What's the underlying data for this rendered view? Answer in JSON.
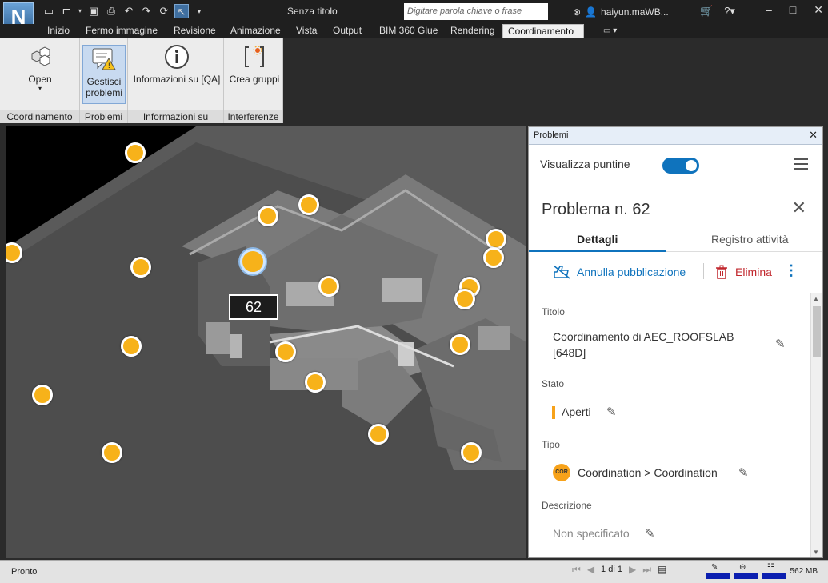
{
  "window": {
    "title": "Senza titolo",
    "search_placeholder": "Digitare parola chiave o frase",
    "user": "haiyun.maWB..."
  },
  "tabs": [
    "Inizio",
    "Fermo immagine",
    "Revisione",
    "Animazione",
    "Vista",
    "Output",
    "BIM 360 Glue",
    "Rendering",
    "Coordinamento"
  ],
  "active_tab": "Coordinamento",
  "ribbon": {
    "open_label": "Open",
    "manage_issues_label_1": "Gestisci",
    "manage_issues_label_2": "problemi",
    "info_qa_label": "Informazioni su [QA]",
    "create_groups_label": "Crea gruppi",
    "group_coordination": "Coordinamento",
    "group_problems": "Problemi",
    "group_info": "Informazioni su",
    "group_clashes": "Interferenze"
  },
  "viewport": {
    "selected_pin_label": "62"
  },
  "panel": {
    "header": "Problemi",
    "show_pins_label": "Visualizza puntine",
    "show_pins_on": true,
    "issue_title": "Problema n. 62",
    "tab_details": "Dettagli",
    "tab_activity": "Registro attività",
    "unpublish": "Annulla pubblicazione",
    "delete": "Elimina",
    "title_label": "Titolo",
    "title_value_1": "Coordinamento di AEC_ROOFSLAB",
    "title_value_2": "[648D]",
    "status_label": "Stato",
    "status_value": "Aperti",
    "type_label": "Tipo",
    "type_badge": "COR",
    "type_value": "Coordination > Coordination",
    "description_label": "Descrizione",
    "description_value": "Non specificato"
  },
  "statusbar": {
    "ready": "Pronto",
    "page": "1 di 1",
    "memory": "562 MB"
  },
  "colors": {
    "accent": "#0f73bd",
    "pin": "#f7b21a",
    "delete": "#c1272d",
    "status_open": "#f7a21a"
  }
}
